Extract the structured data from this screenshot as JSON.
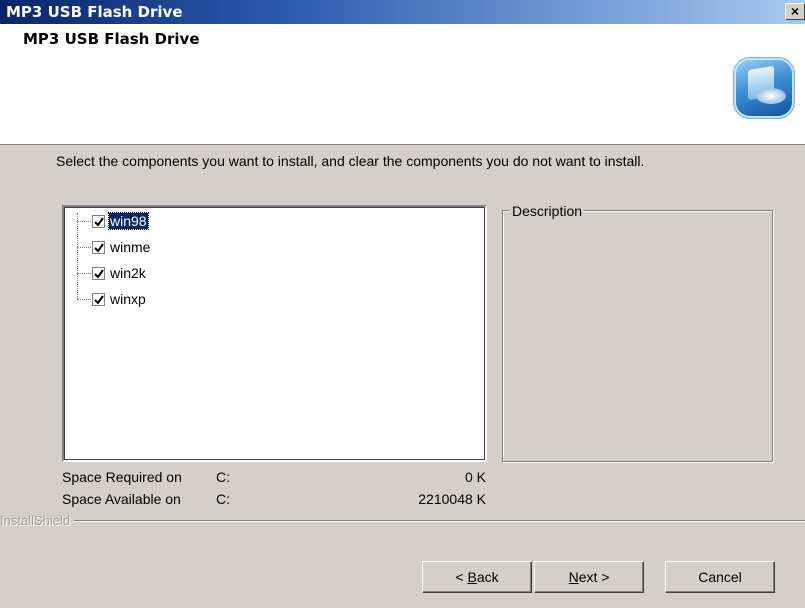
{
  "window": {
    "title": "MP3 USB Flash Drive",
    "close_glyph": "×"
  },
  "header": {
    "title": "MP3 USB Flash Drive",
    "logo_icon": "setup-computer-icon"
  },
  "instruction": "Select the components you want to install, and clear the components you do not want to install.",
  "components": [
    {
      "label": "win98",
      "checked": true,
      "selected": true
    },
    {
      "label": "winme",
      "checked": true,
      "selected": false
    },
    {
      "label": "win2k",
      "checked": true,
      "selected": false
    },
    {
      "label": "winxp",
      "checked": true,
      "selected": false
    }
  ],
  "description": {
    "label": "Description"
  },
  "space": {
    "required_label": "Space Required on",
    "required_drive": "C:",
    "required_value": "0 K",
    "available_label": "Space Available on",
    "available_drive": "C:",
    "available_value": "2210048 K"
  },
  "brand": "InstallShield",
  "buttons": {
    "back": {
      "mnemonic": "B",
      "prefix": "< ",
      "rest": "ack"
    },
    "next": {
      "mnemonic": "N",
      "prefix": "",
      "rest": "ext >"
    },
    "cancel": "Cancel"
  },
  "colors": {
    "title_bar": "#0a246a",
    "selection": "#0a246a",
    "face": "#d4d0c8"
  }
}
